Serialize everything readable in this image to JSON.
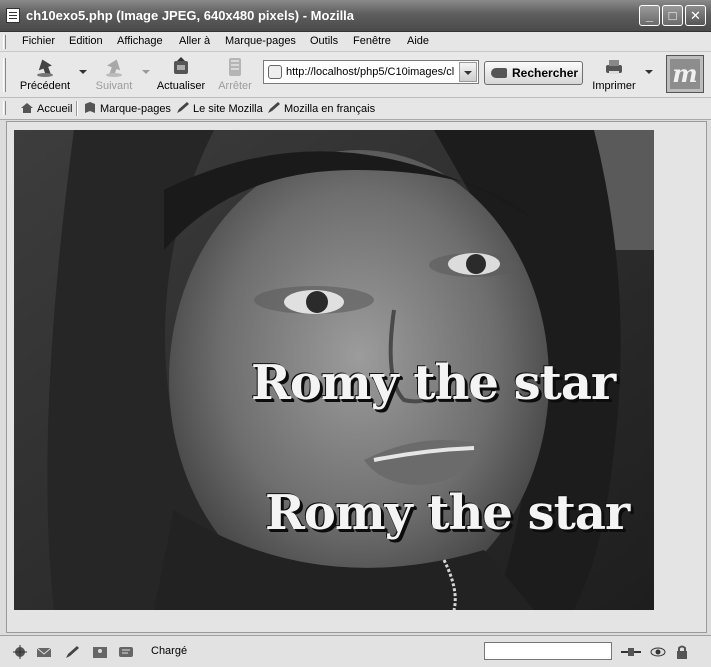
{
  "window": {
    "title": "ch10exo5.php (Image JPEG, 640x480 pixels) - Mozilla",
    "buttons": {
      "minimize": "_",
      "maximize": "□",
      "close": "✕"
    }
  },
  "menu": [
    "Fichier",
    "Edition",
    "Affichage",
    "Aller à",
    "Marque-pages",
    "Outils",
    "Fenêtre",
    "Aide"
  ],
  "toolbar": {
    "back_label": "Précédent",
    "forward_label": "Suivant",
    "reload_label": "Actualiser",
    "stop_label": "Arrêter",
    "url": "http://localhost/php5/C10images/cl",
    "search_label": "Rechercher",
    "print_label": "Imprimer",
    "logo_letter": "m"
  },
  "personal_bar": {
    "items": [
      "Accueil",
      "Marque-pages",
      "Le site Mozilla",
      "Mozilla en français"
    ]
  },
  "image": {
    "caption_top": "Romy the star",
    "caption_bottom": "Romy the star"
  },
  "status": {
    "text": "Chargé",
    "progress": 0
  },
  "colors": {
    "titlebar": "#5e5e5e",
    "chrome": "#e6e6e6"
  }
}
